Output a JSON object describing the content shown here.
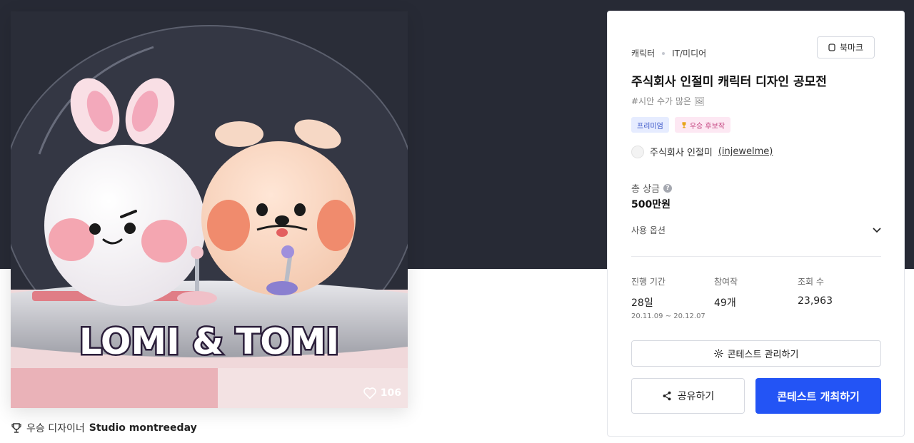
{
  "artwork": {
    "title_text": "LOMI & TOMI",
    "likes": "106",
    "icons": {
      "like": "heart-icon"
    }
  },
  "award_line": {
    "prefix": "우승 디자이너",
    "designer": "Studio montreeday",
    "icon": "trophy-icon"
  },
  "panel": {
    "categories": [
      "캐릭터",
      "IT/미디어"
    ],
    "bookmark_label": "북마크",
    "title": "주식회사 인절미 캐릭터 디자인 공모전",
    "tags": "#시안 수가 많은 🖼",
    "badges": {
      "premium": "프리미엄",
      "award": "우승 후보작"
    },
    "host": {
      "name": "주식회사 인절미",
      "handle": "(injewelme)"
    },
    "prize": {
      "label": "총 상금",
      "amount": "500만원"
    },
    "usage_label": "사용 옵션",
    "stats": {
      "period": {
        "label": "진행 기간",
        "value": "28일",
        "range": "20.11.09 ~ 20.12.07"
      },
      "entries": {
        "label": "참여작",
        "value": "49개"
      },
      "views": {
        "label": "조회 수",
        "value": "23,963"
      }
    },
    "buttons": {
      "manage": "콘테스트 관리하기",
      "share": "공유하기",
      "host": "콘테스트 개최하기"
    }
  },
  "colors": {
    "hero_bg": "#272a35",
    "primary": "#2354f5",
    "premium_bg": "#e6ecff",
    "award_bg": "#fde8f3"
  }
}
